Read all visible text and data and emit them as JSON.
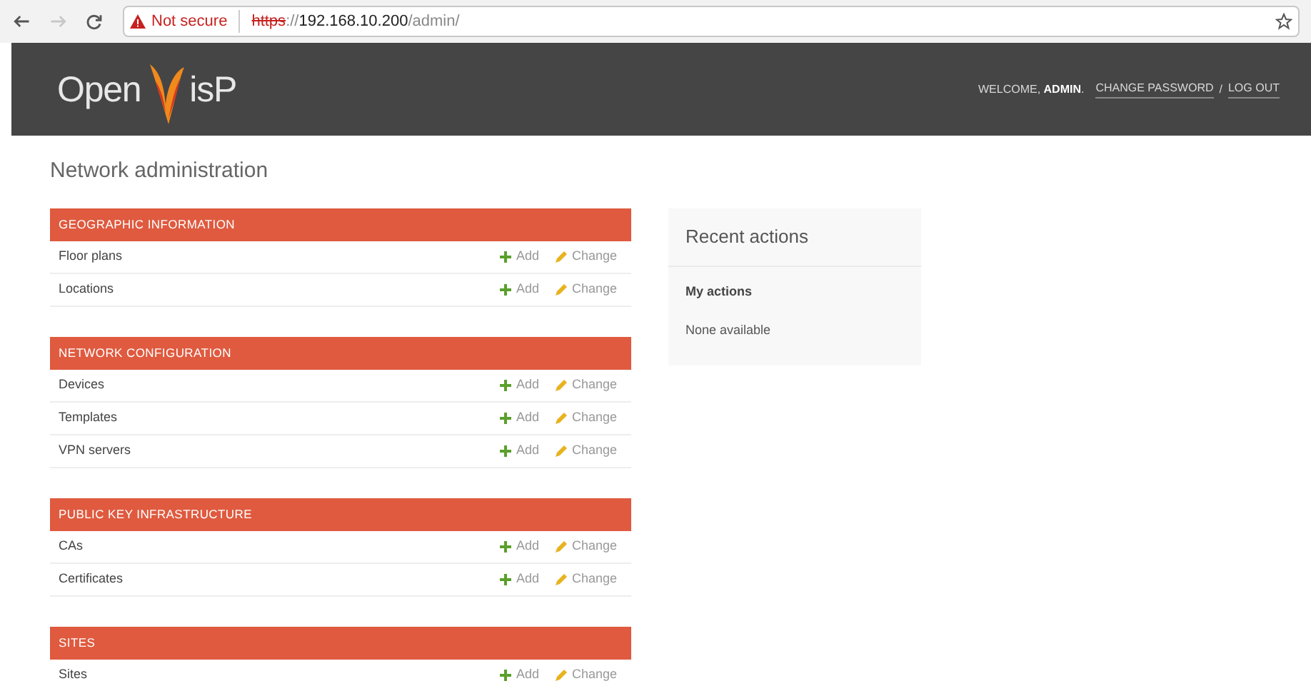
{
  "browser": {
    "nav": [
      {
        "kind": "back",
        "disabled": false
      },
      {
        "kind": "forward",
        "disabled": true
      },
      {
        "kind": "reload",
        "disabled": false
      }
    ],
    "security": "Not secure",
    "url": [
      {
        "kind": "scheme",
        "text": "https"
      },
      {
        "kind": "plain",
        "text": "://"
      },
      {
        "kind": "host",
        "text": "192.168.10.200"
      },
      {
        "kind": "plain",
        "text": "/admin/"
      }
    ]
  },
  "header": {
    "logo": {
      "before": "Open",
      "after": "isP"
    },
    "user_tools": {
      "welcome": "WELCOME, **ADMIN**.",
      "links": [
        {
          "kind": "link",
          "text": "CHANGE PASSWORD"
        },
        {
          "kind": "sep",
          "text": "/"
        },
        {
          "kind": "link",
          "text": "LOG OUT"
        }
      ]
    }
  },
  "title": "Network administration",
  "modules": [
    {
      "caption": "GEOGRAPHIC INFORMATION",
      "rows": [
        {
          "name": "Floor plans",
          "add": "Add",
          "change": "Change"
        },
        {
          "name": "Locations",
          "add": "Add",
          "change": "Change"
        }
      ]
    },
    {
      "caption": "NETWORK CONFIGURATION",
      "rows": [
        {
          "name": "Devices",
          "add": "Add",
          "change": "Change"
        },
        {
          "name": "Templates",
          "add": "Add",
          "change": "Change"
        },
        {
          "name": "VPN servers",
          "add": "Add",
          "change": "Change"
        }
      ]
    },
    {
      "caption": "PUBLIC KEY INFRASTRUCTURE",
      "rows": [
        {
          "name": "CAs",
          "add": "Add",
          "change": "Change"
        },
        {
          "name": "Certificates",
          "add": "Add",
          "change": "Change"
        }
      ]
    },
    {
      "caption": "SITES",
      "rows": [
        {
          "name": "Sites",
          "add": "Add",
          "change": "Change"
        }
      ]
    }
  ],
  "recent": {
    "title": "Recent actions",
    "subtitle": "My actions",
    "empty": "None available"
  }
}
